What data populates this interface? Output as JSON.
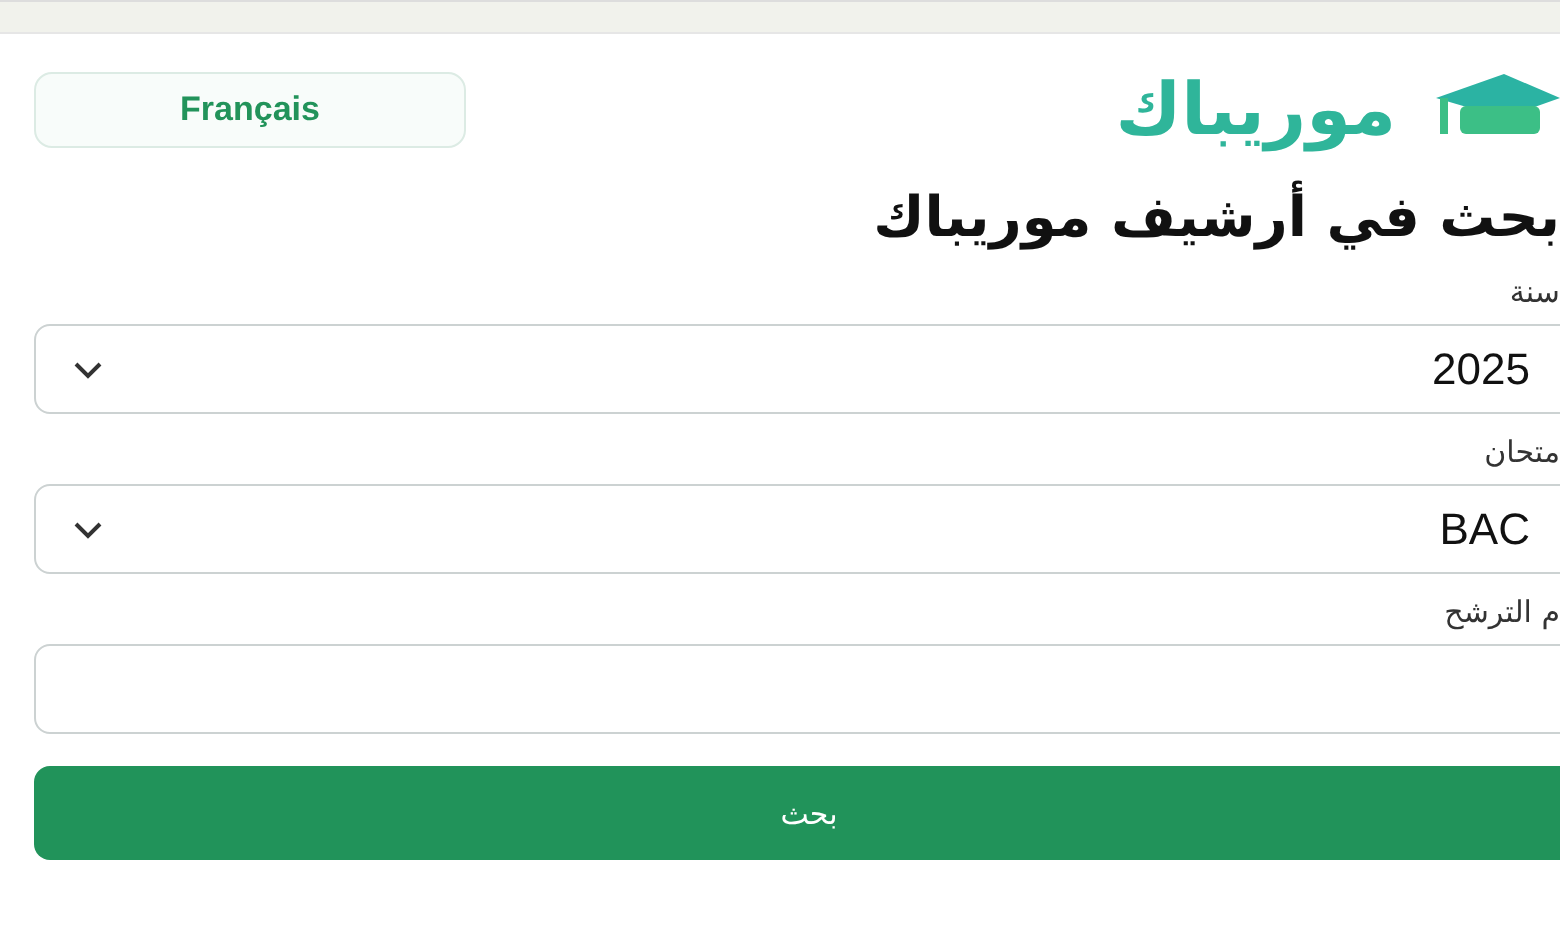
{
  "header": {
    "language_button": "Français",
    "logo": "موريباك"
  },
  "title": "بحث في أرشيف موريباك",
  "fields": [
    {
      "kind": "select",
      "label": "سنة",
      "value": "2025"
    },
    {
      "kind": "select",
      "label": "متحان",
      "value": "BAC"
    },
    {
      "kind": "input",
      "label": "م الترشح"
    }
  ],
  "submit_button": "بحث"
}
